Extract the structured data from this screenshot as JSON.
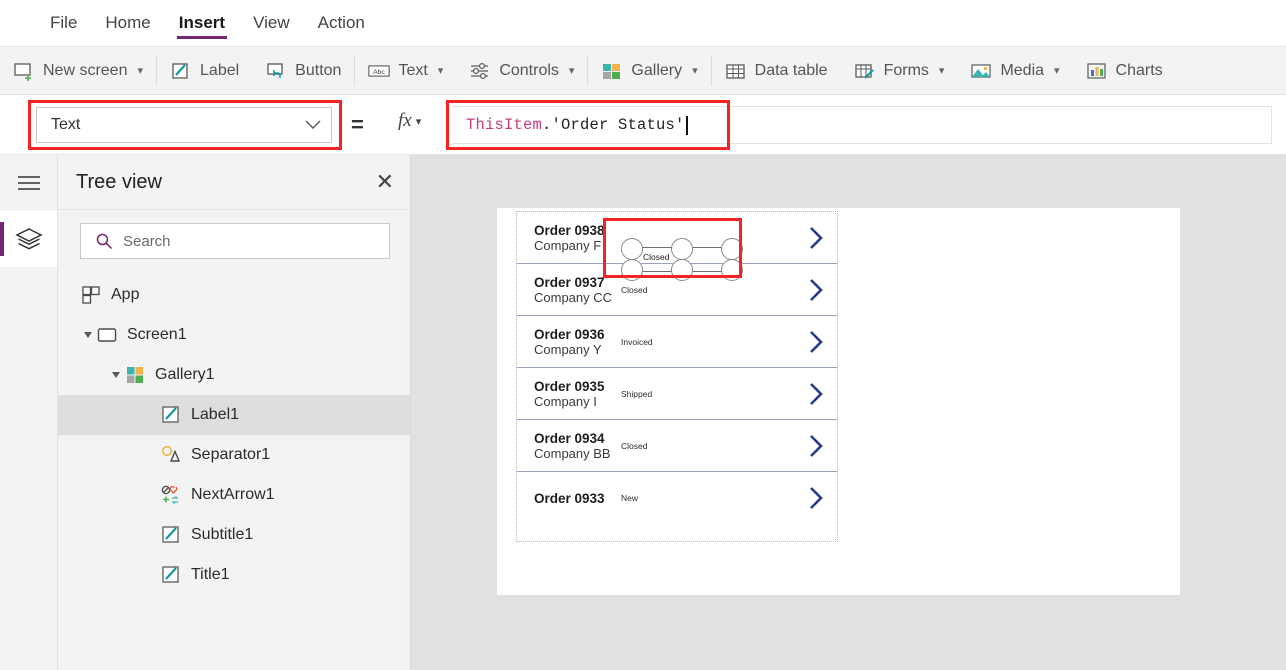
{
  "menu": {
    "tabs": [
      {
        "label": "File",
        "active": false
      },
      {
        "label": "Home",
        "active": false
      },
      {
        "label": "Insert",
        "active": true
      },
      {
        "label": "View",
        "active": false
      },
      {
        "label": "Action",
        "active": false
      }
    ]
  },
  "ribbon": {
    "items": [
      {
        "label": "New screen",
        "icon": "new-screen-icon",
        "caret": true
      },
      {
        "label": "Label",
        "icon": "label-icon",
        "caret": false
      },
      {
        "label": "Button",
        "icon": "button-icon",
        "caret": false
      },
      {
        "label": "Text",
        "icon": "text-abc-icon",
        "caret": true
      },
      {
        "label": "Controls",
        "icon": "controls-sliders-icon",
        "caret": true
      },
      {
        "label": "Gallery",
        "icon": "gallery-grid-icon",
        "caret": true
      },
      {
        "label": "Data table",
        "icon": "data-table-icon",
        "caret": false
      },
      {
        "label": "Forms",
        "icon": "forms-icon",
        "caret": true
      },
      {
        "label": "Media",
        "icon": "media-image-icon",
        "caret": true
      },
      {
        "label": "Charts",
        "icon": "charts-bar-icon",
        "caret": false
      }
    ]
  },
  "formula_bar": {
    "property_selected": "Text",
    "equals_sign": "=",
    "fx_label": "fx",
    "formula_token": "ThisItem",
    "formula_rest": ".'Order Status'"
  },
  "tree_view": {
    "title": "Tree view",
    "search_placeholder": "Search",
    "items": [
      {
        "label": "App",
        "icon": "app-icon",
        "indent": 0,
        "triangle": "none",
        "selected": false
      },
      {
        "label": "Screen1",
        "icon": "screen-icon",
        "indent": 1,
        "triangle": "expanded",
        "selected": false
      },
      {
        "label": "Gallery1",
        "icon": "gallery-icon",
        "indent": 2,
        "triangle": "expanded",
        "selected": false
      },
      {
        "label": "Label1",
        "icon": "label-icon",
        "indent": 3,
        "triangle": "none",
        "selected": true
      },
      {
        "label": "Separator1",
        "icon": "separator-icon",
        "indent": 3,
        "triangle": "none",
        "selected": false
      },
      {
        "label": "NextArrow1",
        "icon": "icons-icon",
        "indent": 3,
        "triangle": "none",
        "selected": false
      },
      {
        "label": "Subtitle1",
        "icon": "label-icon",
        "indent": 3,
        "triangle": "none",
        "selected": false
      },
      {
        "label": "Title1",
        "icon": "label-icon",
        "indent": 3,
        "triangle": "none",
        "selected": false
      }
    ]
  },
  "canvas": {
    "gallery_rows": [
      {
        "title": "Order 0938",
        "subtitle": "Company F",
        "status": "Closed",
        "selected": true,
        "clipped": false
      },
      {
        "title": "Order 0937",
        "subtitle": "Company CC",
        "status": "Closed",
        "selected": false,
        "clipped": false
      },
      {
        "title": "Order 0936",
        "subtitle": "Company Y",
        "status": "Invoiced",
        "selected": false,
        "clipped": false
      },
      {
        "title": "Order 0935",
        "subtitle": "Company I",
        "status": "Shipped",
        "selected": false,
        "clipped": false
      },
      {
        "title": "Order 0934",
        "subtitle": "Company BB",
        "status": "Closed",
        "selected": false,
        "clipped": false
      },
      {
        "title": "Order 0933",
        "subtitle": "",
        "status": "New",
        "selected": false,
        "clipped": true
      }
    ]
  },
  "colors": {
    "accent_purple": "#742774",
    "annotation_red": "#f52424",
    "chevron_blue": "#2b3a8f",
    "row_separator": "#9aa3c4",
    "canvas_bg": "#e1e1e1",
    "panel_bg": "#f3f3f3",
    "selection_gray": "#dedede"
  }
}
